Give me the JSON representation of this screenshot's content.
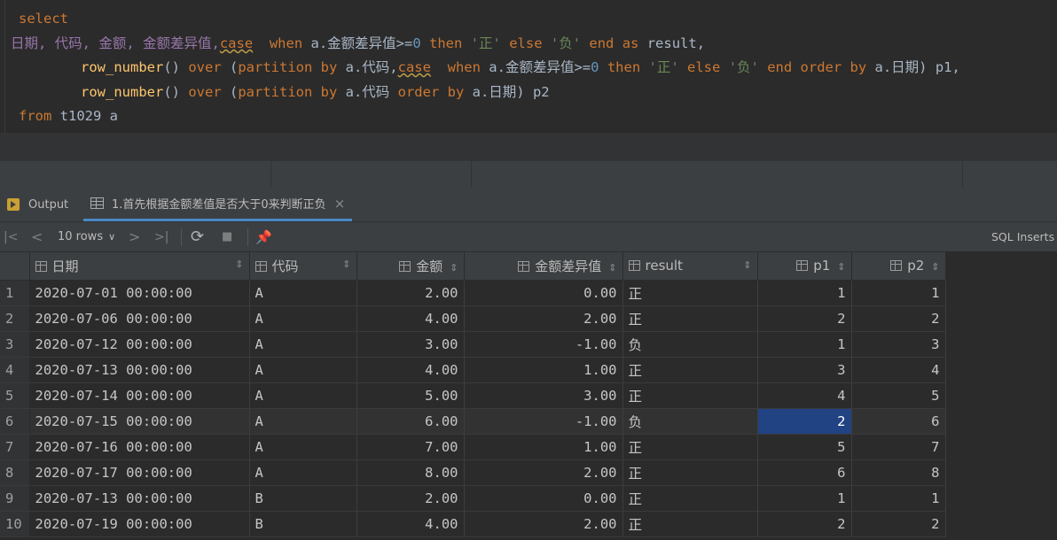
{
  "editor": {
    "line1": "select",
    "line2_cols": "日期, 代码, 金额, 金额差异值,",
    "line2_case": "case",
    "line2_when": "when",
    "line2_cond": " a.金额差异值>=",
    "line2_zero": "0",
    "line2_then": "then",
    "line2_str1": "'正'",
    "line2_else": "else",
    "line2_str2": "'负'",
    "line2_end": "end as",
    "line2_alias": " result,",
    "line3_fn": "row_number",
    "line3_over": "over",
    "line3_part": "partition by",
    "line3_col": " a.代码,",
    "line3_case": "case",
    "line3_when": "when",
    "line3_cond": " a.金额差异值>=",
    "line3_zero": "0",
    "line3_then": "then",
    "line3_str1": "'正'",
    "line3_else": "else",
    "line3_str2": "'负'",
    "line3_end": "end order by",
    "line3_tail": " a.日期) p1,",
    "line4_fn": "row_number",
    "line4_over": "over",
    "line4_part": "partition by",
    "line4_col": " a.代码 ",
    "line4_order": "order by",
    "line4_tail": " a.日期) p2",
    "line5_from": "from",
    "line5_table": " t1029 a"
  },
  "tabs": {
    "output_label": "Output",
    "result_label": "1.首先根据金额差值是否大于0来判断正负",
    "close_glyph": "×"
  },
  "toolbar": {
    "rows_label": "10 rows",
    "first_glyph": "|<",
    "prev_glyph": "<",
    "next_glyph": ">",
    "last_glyph": ">|",
    "refresh_glyph": "⟳",
    "stop_glyph": "■",
    "pin_glyph": "📌",
    "sql_inserts_label": "SQL Inserts"
  },
  "grid": {
    "columns": [
      "日期",
      "代码",
      "金额",
      "金额差异值",
      "result",
      "p1",
      "p2"
    ],
    "sort_glyph": "⇕",
    "rows": [
      {
        "n": "1",
        "date": "2020-07-01 00:00:00",
        "code": "A",
        "amt": "2.00",
        "diff": "0.00",
        "res": "正",
        "p1": "1",
        "p2": "1"
      },
      {
        "n": "2",
        "date": "2020-07-06 00:00:00",
        "code": "A",
        "amt": "4.00",
        "diff": "2.00",
        "res": "正",
        "p1": "2",
        "p2": "2"
      },
      {
        "n": "3",
        "date": "2020-07-12 00:00:00",
        "code": "A",
        "amt": "3.00",
        "diff": "-1.00",
        "res": "负",
        "p1": "1",
        "p2": "3"
      },
      {
        "n": "4",
        "date": "2020-07-13 00:00:00",
        "code": "A",
        "amt": "4.00",
        "diff": "1.00",
        "res": "正",
        "p1": "3",
        "p2": "4"
      },
      {
        "n": "5",
        "date": "2020-07-14 00:00:00",
        "code": "A",
        "amt": "5.00",
        "diff": "3.00",
        "res": "正",
        "p1": "4",
        "p2": "5"
      },
      {
        "n": "6",
        "date": "2020-07-15 00:00:00",
        "code": "A",
        "amt": "6.00",
        "diff": "-1.00",
        "res": "负",
        "p1": "2",
        "p2": "6"
      },
      {
        "n": "7",
        "date": "2020-07-16 00:00:00",
        "code": "A",
        "amt": "7.00",
        "diff": "1.00",
        "res": "正",
        "p1": "5",
        "p2": "7"
      },
      {
        "n": "8",
        "date": "2020-07-17 00:00:00",
        "code": "A",
        "amt": "8.00",
        "diff": "2.00",
        "res": "正",
        "p1": "6",
        "p2": "8"
      },
      {
        "n": "9",
        "date": "2020-07-13 00:00:00",
        "code": "B",
        "amt": "2.00",
        "diff": "0.00",
        "res": "正",
        "p1": "1",
        "p2": "1"
      },
      {
        "n": "10",
        "date": "2020-07-19 00:00:00",
        "code": "B",
        "amt": "4.00",
        "diff": "2.00",
        "res": "正",
        "p1": "2",
        "p2": "2"
      }
    ],
    "selection_color": "#214283"
  }
}
